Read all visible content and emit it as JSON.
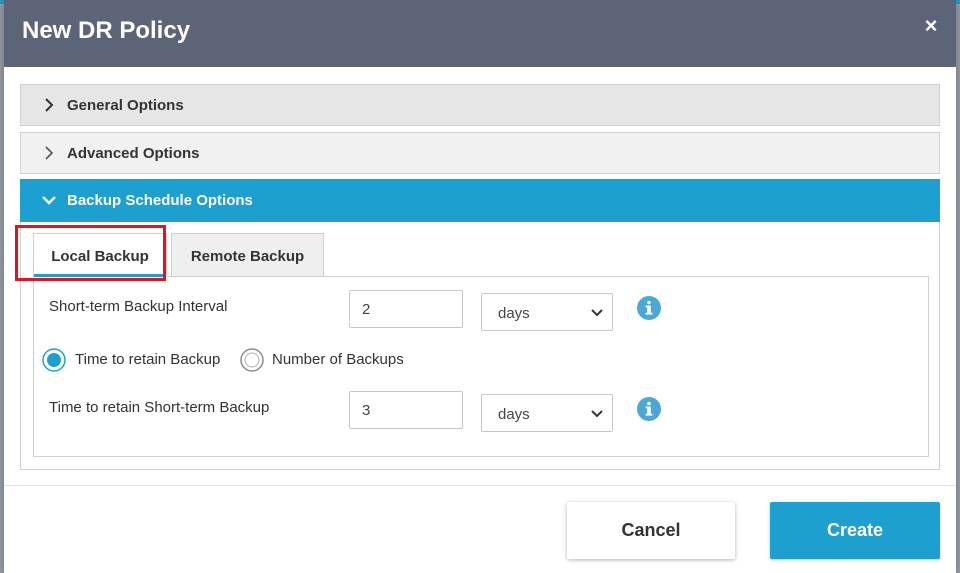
{
  "dialog": {
    "title": "New DR Policy",
    "close_glyph": "×"
  },
  "panels": {
    "general": {
      "label": "General Options",
      "expanded": false
    },
    "advanced": {
      "label": "Advanced Options",
      "expanded": false
    },
    "backup_schedule": {
      "label": "Backup Schedule Options",
      "expanded": true
    }
  },
  "tabs": {
    "local": {
      "label": "Local Backup",
      "active": true
    },
    "remote": {
      "label": "Remote Backup",
      "active": false
    }
  },
  "form": {
    "interval": {
      "label": "Short-term Backup Interval",
      "value": "2",
      "unit": "days"
    },
    "retain_mode": {
      "option_time": "Time to retain Backup",
      "option_count": "Number of Backups",
      "selected": "time"
    },
    "retain": {
      "label": "Time to retain Short-term Backup",
      "value": "3",
      "unit": "days"
    }
  },
  "footer": {
    "cancel_label": "Cancel",
    "create_label": "Create"
  },
  "colors": {
    "header_bg": "#5c6478",
    "accent": "#1d9fd0",
    "highlight": "#e0141e"
  },
  "icons": {
    "close": "close-icon",
    "collapsed": "chevron-right-icon",
    "expanded": "chevron-down-icon",
    "info": "info-icon",
    "dropdown": "chevron-down-icon"
  }
}
